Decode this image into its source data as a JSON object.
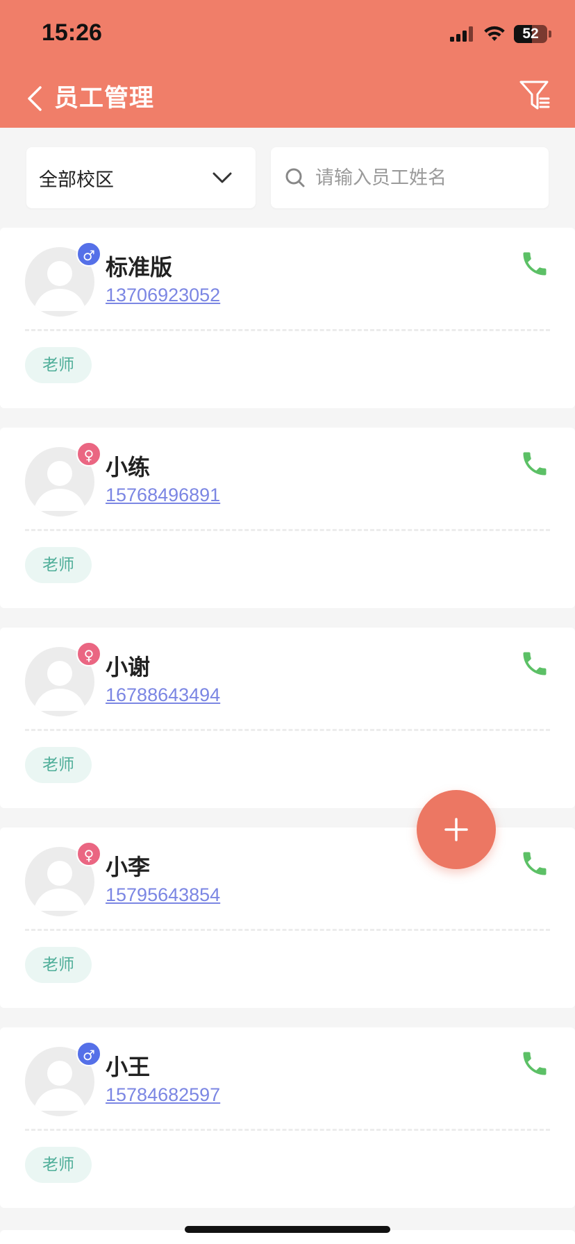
{
  "status_bar": {
    "time": "15:26",
    "battery": "52"
  },
  "header": {
    "title": "员工管理"
  },
  "filters": {
    "campus": "全部校区",
    "search_placeholder": "请输入员工姓名"
  },
  "employees": [
    {
      "name": "标准版",
      "phone": "13706923052",
      "gender": "♂",
      "role": "老师"
    },
    {
      "name": "小练",
      "phone": "15768496891",
      "gender": "♀",
      "role": "老师"
    },
    {
      "name": "小谢",
      "phone": "16788643494",
      "gender": "♀",
      "role": "老师"
    },
    {
      "name": "小李",
      "phone": "15795643854",
      "gender": "♀",
      "role": "老师"
    },
    {
      "name": "小王",
      "phone": "15784682597",
      "gender": "♂",
      "role": "老师"
    }
  ],
  "colors": {
    "header_bg": "#f07e69",
    "male_badge": "#5570e8",
    "female_badge": "#ea6682",
    "phone_link": "#7b86e3",
    "call_icon": "#5cc066",
    "role_tag_text": "#4fae99"
  },
  "icons": {
    "back": "chevron-left-icon",
    "filter": "filter-icon",
    "dropdown": "chevron-down-icon",
    "search": "search-icon",
    "call": "phone-icon",
    "add": "plus-icon"
  }
}
